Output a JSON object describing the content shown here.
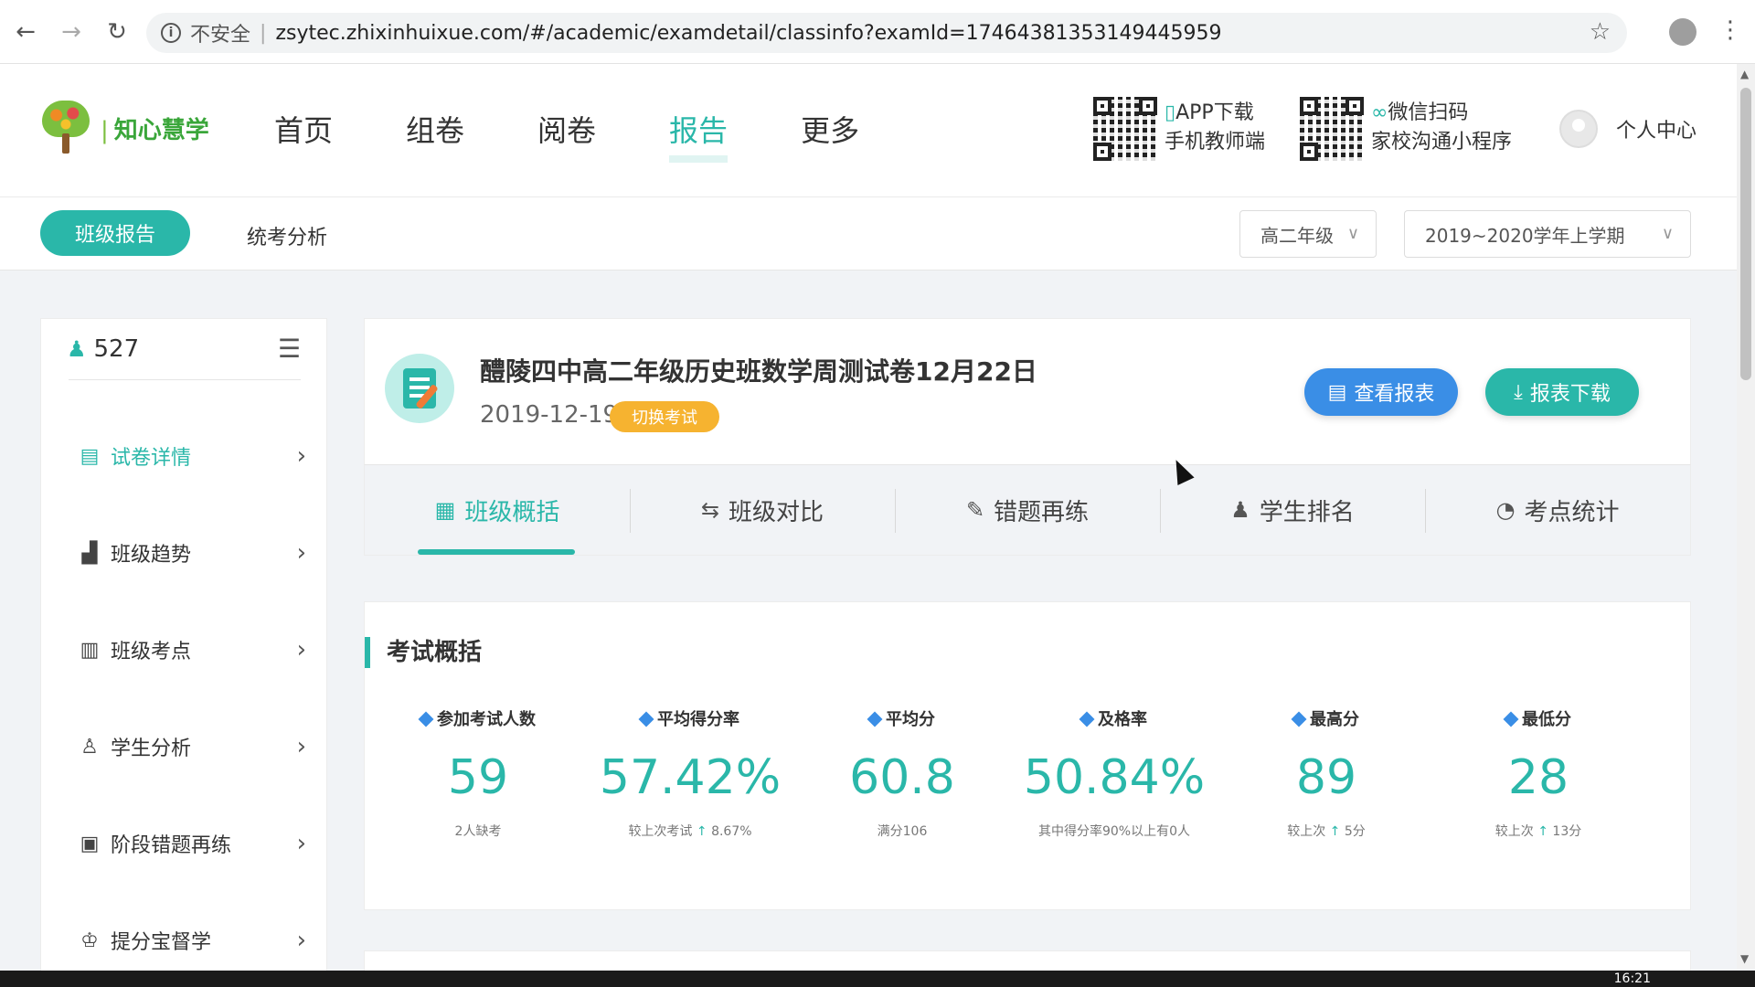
{
  "browser": {
    "insecure_label": "不安全",
    "url": "zsytec.zhixinhuixue.com/#/academic/examdetail/classinfo?examId=1746438135314944595­9"
  },
  "header": {
    "logo_text": "知心慧学",
    "nav": [
      "首页",
      "组卷",
      "阅卷",
      "报告",
      "更多"
    ],
    "active_nav": "报告",
    "qr1_line1": "APP下载",
    "qr1_line2": "手机教师端",
    "qr2_line1": "微信扫码",
    "qr2_line2": "家校沟通小程序",
    "user_center": "个人中心"
  },
  "subbar": {
    "active_tab": "班级报告",
    "tab2": "统考分析",
    "grade_select": "高二年级",
    "term_select": "2019~2020学年上学期"
  },
  "sidebar": {
    "count": "527",
    "items": [
      {
        "label": "试卷详情"
      },
      {
        "label": "班级趋势"
      },
      {
        "label": "班级考点"
      },
      {
        "label": "学生分析"
      },
      {
        "label": "阶段错题再练"
      },
      {
        "label": "提分宝督学"
      }
    ]
  },
  "exam": {
    "title": "醴陵四中高二年级历史班数学周测试卷12月22日",
    "date": "2019-12-19",
    "switch_label": "切换考试",
    "view_report": "查看报表",
    "download_report": "报表下载"
  },
  "tabs": [
    "班级概括",
    "班级对比",
    "错题再练",
    "学生排名",
    "考点统计"
  ],
  "summary": {
    "title": "考试概括",
    "stats": [
      {
        "label": "参加考试人数",
        "value": "59",
        "sub": "2人缺考"
      },
      {
        "label": "平均得分率",
        "value": "57.42%",
        "sub_prefix": "较上次考试",
        "sub_arrow": "↑",
        "sub_value": "8.67%"
      },
      {
        "label": "平均分",
        "value": "60.8",
        "sub": "满分106"
      },
      {
        "label": "及格率",
        "value": "50.84%",
        "sub": "其中得分率90%以上有0人"
      },
      {
        "label": "最高分",
        "value": "89",
        "sub_prefix": "较上次",
        "sub_arrow": "↑",
        "sub_value": "5分"
      },
      {
        "label": "最低分",
        "value": "28",
        "sub_prefix": "较上次",
        "sub_arrow": "↑",
        "sub_value": "13分"
      }
    ]
  },
  "taskbar": {
    "clock": "16:21"
  },
  "colors": {
    "accent": "#2ab7a9",
    "primary_blue": "#3a8ee6",
    "warning": "#f6b330"
  }
}
